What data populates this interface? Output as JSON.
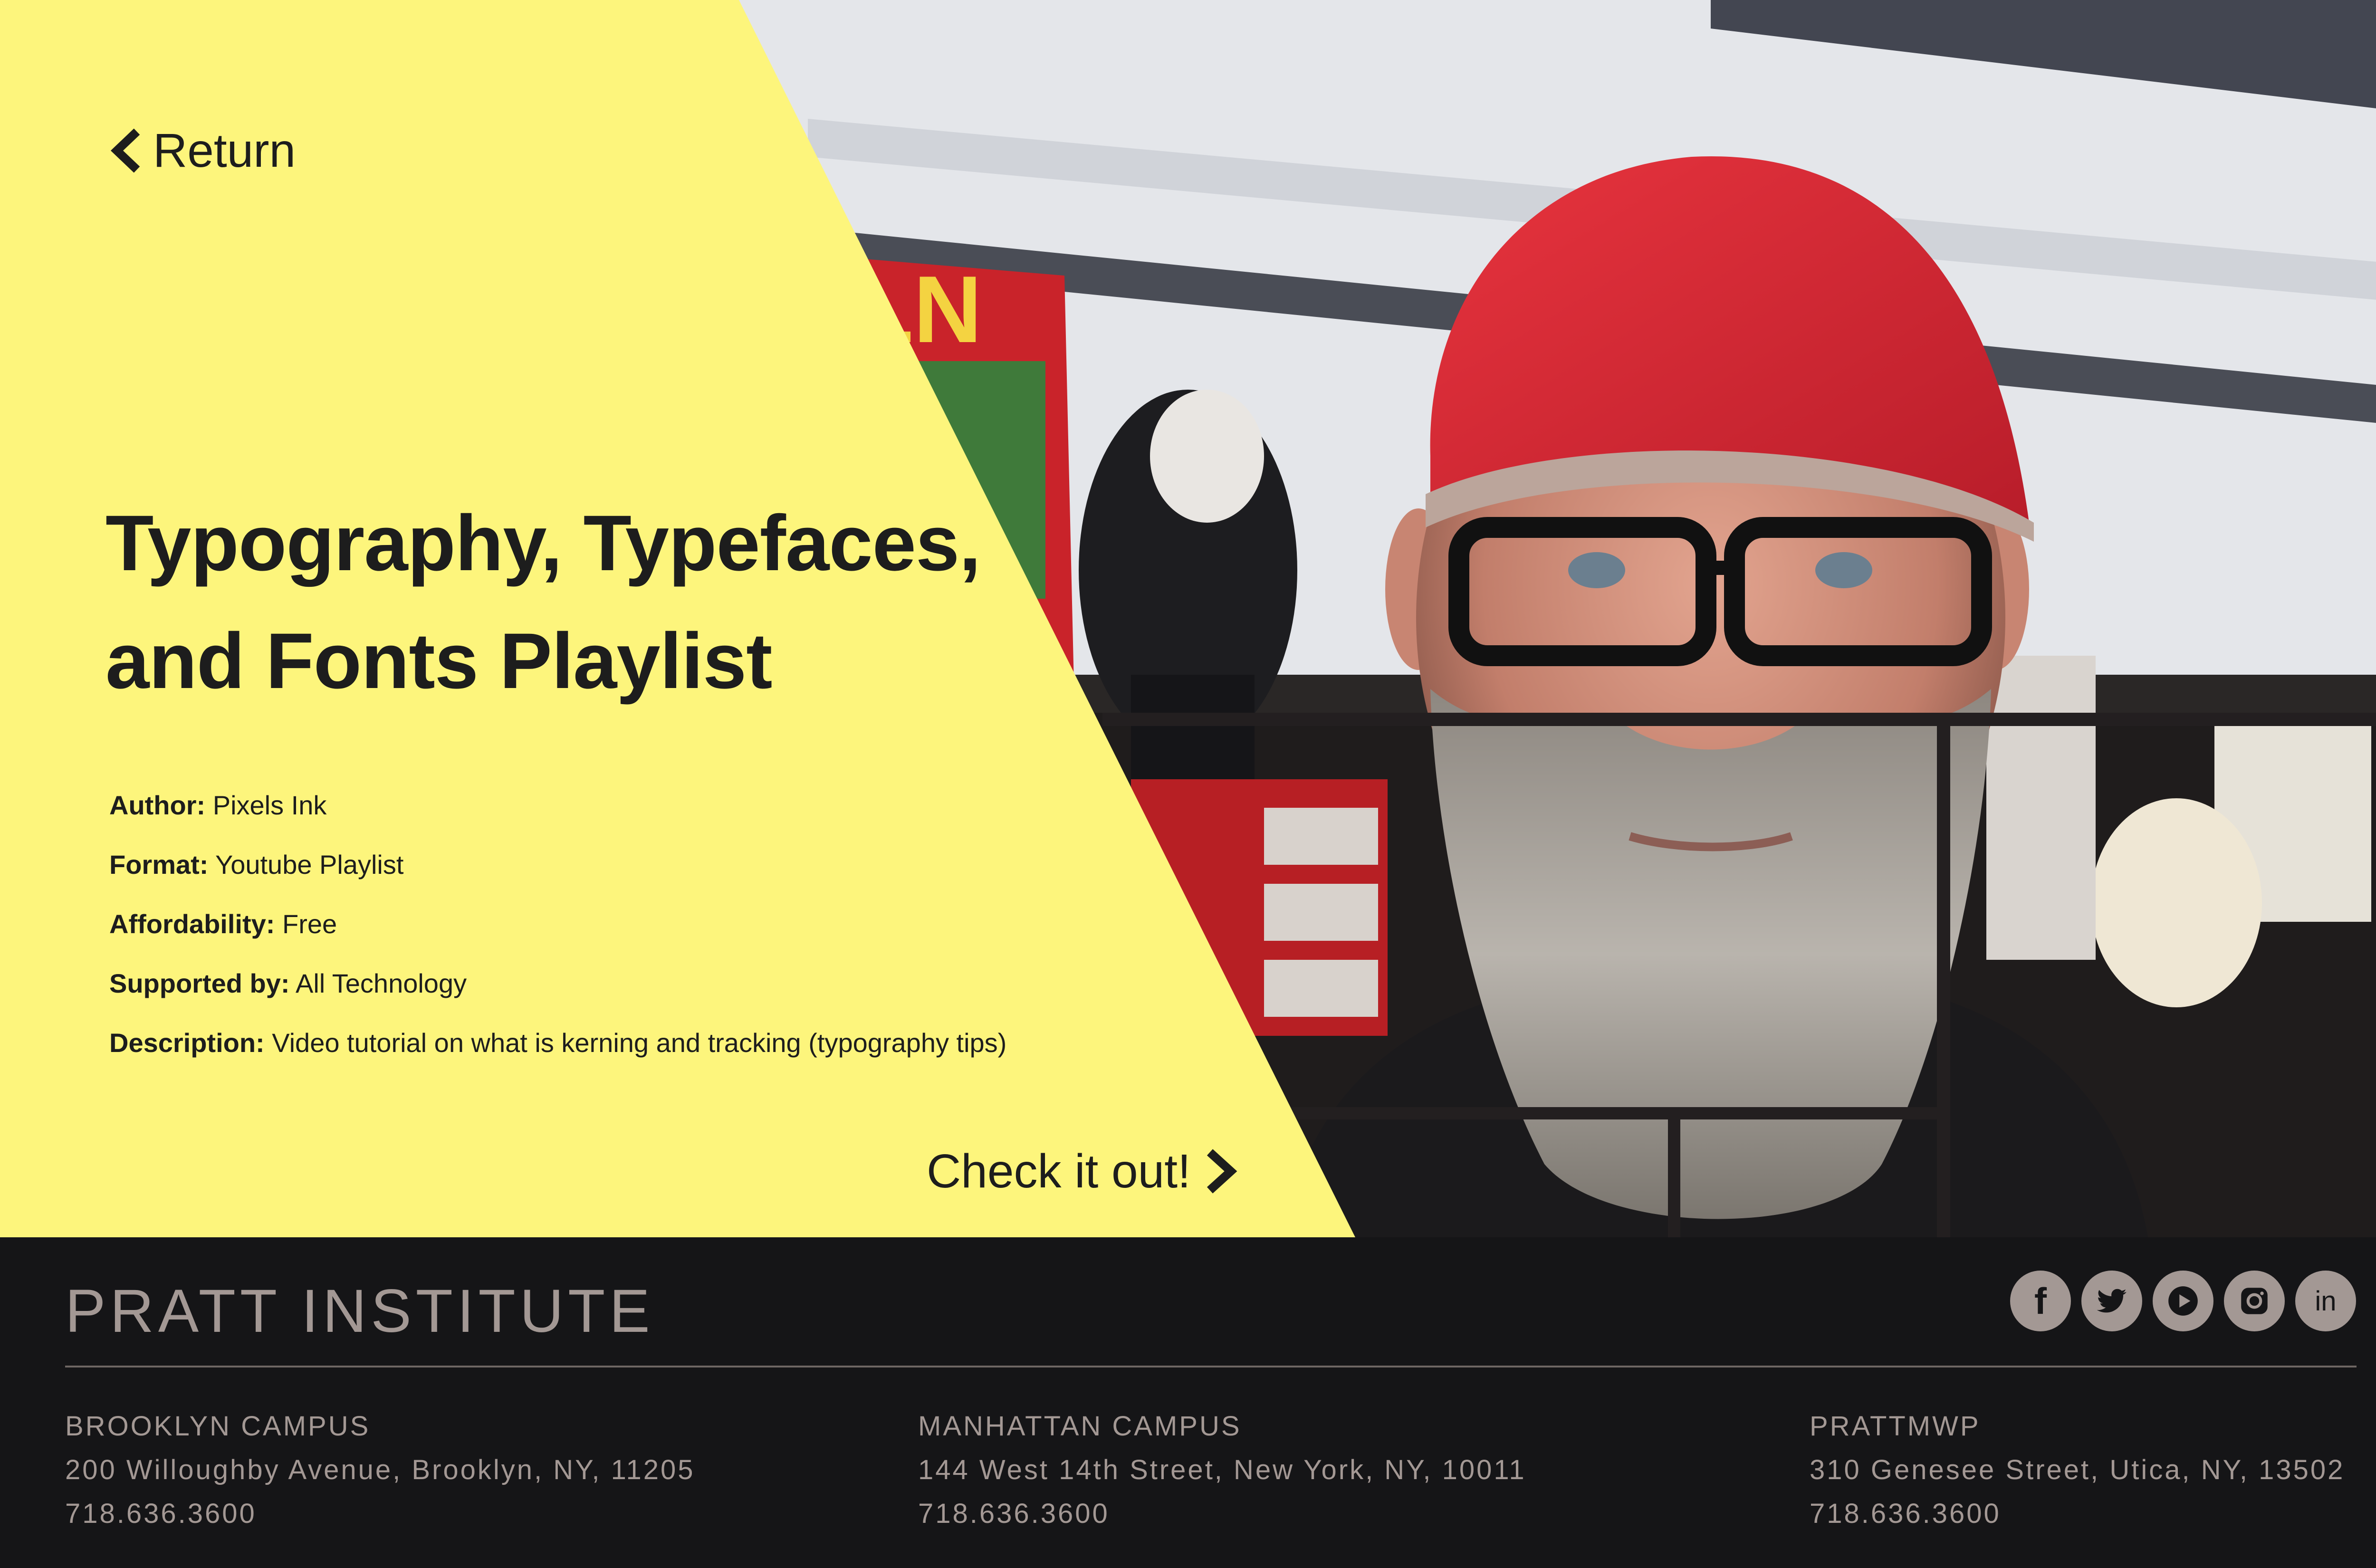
{
  "nav": {
    "return_label": "Return"
  },
  "resource": {
    "title_line1": "Typography, Typefaces,",
    "title_line2": "and Fonts Playlist",
    "details": [
      {
        "key": "Author:",
        "value": "Pixels Ink"
      },
      {
        "key": "Format:",
        "value": "Youtube Playlist"
      },
      {
        "key": "Affordability:",
        "value": "Free"
      },
      {
        "key": "Supported by:",
        "value": "All Technology"
      },
      {
        "key": "Description:",
        "value": "Video tutorial on what is kerning and tracking (typography tips)"
      }
    ],
    "cta_label": "Check it out!"
  },
  "colors": {
    "panel": "#fdf57c",
    "text": "#1d1d1d",
    "footer_bg": "#151517",
    "footer_text": "#a39894"
  },
  "footer": {
    "brand": "PRATT INSTITUTE",
    "social": [
      {
        "icon": "facebook-icon",
        "glyph": "f"
      },
      {
        "icon": "twitter-icon",
        "glyph": ""
      },
      {
        "icon": "youtube-icon",
        "glyph": ""
      },
      {
        "icon": "instagram-icon",
        "glyph": ""
      },
      {
        "icon": "linkedin-icon",
        "glyph": "in"
      }
    ],
    "campuses": [
      {
        "name": "BROOKLYN CAMPUS",
        "address": "200 Willoughby Avenue, Brooklyn, NY, 11205",
        "phone": "718.636.3600"
      },
      {
        "name": "MANHATTAN CAMPUS",
        "address": "144 West 14th Street, New York, NY, 10011",
        "phone": "718.636.3600"
      },
      {
        "name": "PRATTMWP",
        "address": "310 Genesee Street, Utica, NY, 13502",
        "phone": "718.636.3600"
      }
    ]
  }
}
